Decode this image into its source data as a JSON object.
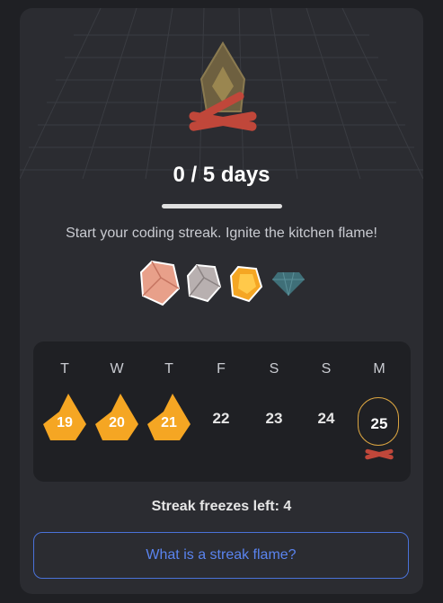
{
  "streak": {
    "progress_label": "0 / 5 days",
    "progress_fraction": 0,
    "subtitle": "Start your coding streak. Ignite the kitchen flame!"
  },
  "gems": [
    {
      "name": "copper-gem-icon",
      "color": "#e8a08a"
    },
    {
      "name": "silver-gem-icon",
      "color": "#b8b0b0"
    },
    {
      "name": "gold-gem-icon",
      "color": "#f5a623"
    },
    {
      "name": "diamond-gem-icon",
      "color": "#3f6f78"
    }
  ],
  "calendar": {
    "days": [
      {
        "letter": "T",
        "num": "19",
        "state": "flame"
      },
      {
        "letter": "W",
        "num": "20",
        "state": "flame"
      },
      {
        "letter": "T",
        "num": "21",
        "state": "flame"
      },
      {
        "letter": "F",
        "num": "22",
        "state": "plain"
      },
      {
        "letter": "S",
        "num": "23",
        "state": "plain"
      },
      {
        "letter": "S",
        "num": "24",
        "state": "plain"
      },
      {
        "letter": "M",
        "num": "25",
        "state": "today"
      }
    ]
  },
  "freezes_label": "Streak freezes left: 4",
  "help_button_label": "What is a streak flame?",
  "colors": {
    "flame": "#f5a623",
    "logs": "#c0473a",
    "accent_blue": "#5a84f0",
    "today_ring": "#d9a441"
  }
}
